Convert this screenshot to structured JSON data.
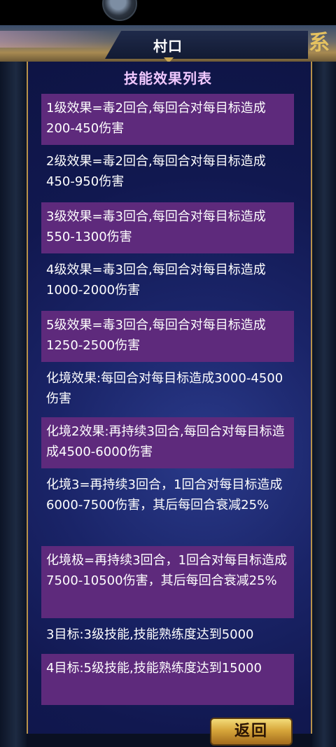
{
  "header": {
    "title": "村口",
    "emblem": "系"
  },
  "panel": {
    "heading": "技能效果列表"
  },
  "effects": [
    {
      "text": "1级效果=毒2回合,每回合对每目标造成200-450伤害",
      "shaded": true
    },
    {
      "text": "2级效果=毒2回合,每回合对每目标造成450-950伤害",
      "shaded": false
    },
    {
      "text": "3级效果=毒3回合,每回合对每目标造成550-1300伤害",
      "shaded": true
    },
    {
      "text": "4级效果=毒3回合,每回合对每目标造成1000-2000伤害",
      "shaded": false
    },
    {
      "text": "5级效果=毒3回合,每回合对每目标造成1250-2500伤害",
      "shaded": true
    },
    {
      "text": "化境效果:每回合对每目标造成3000-4500伤害",
      "shaded": false
    },
    {
      "text": "化境2效果:再持续3回合,每回合对每目标造成4500-6000伤害",
      "shaded": true
    },
    {
      "text": "化境3=再持续3回合，1回合对每目标造成6000-7500伤害，其后每回合衰减25%",
      "shaded": false
    },
    {
      "text": "化境极=再持续3回合，1回合对每目标造成7500-10500伤害，其后每回合衰减25%",
      "shaded": true
    },
    {
      "text": "3目标:3级技能,技能熟练度达到5000",
      "shaded": false
    },
    {
      "text": "4目标:5级技能,技能熟练度达到15000",
      "shaded": true
    }
  ],
  "footer": {
    "back_label": "返回"
  }
}
